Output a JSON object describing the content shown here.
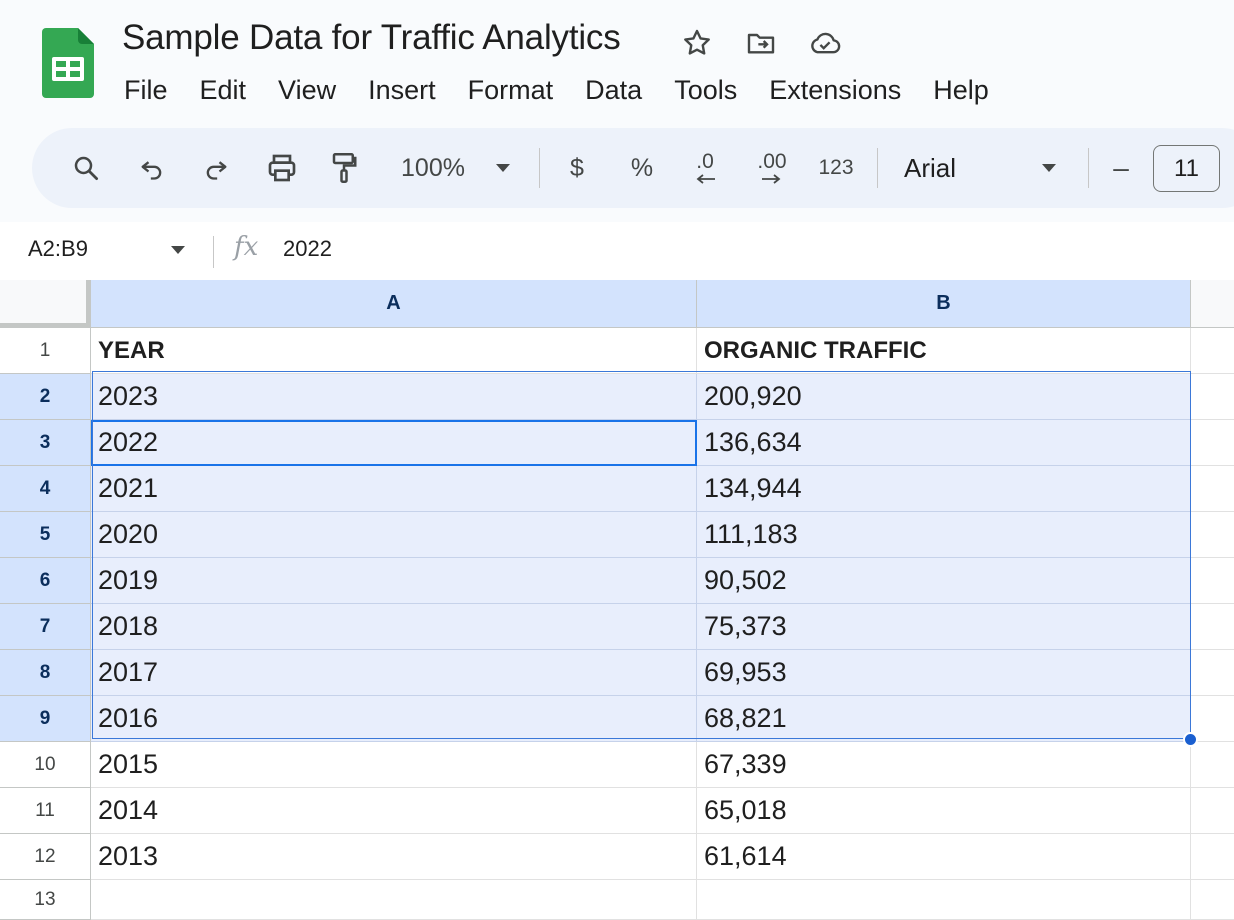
{
  "document": {
    "title": "Sample Data for Traffic Analytics"
  },
  "title_icons": [
    "star-icon",
    "move-to-folder-icon",
    "cloud-saved-icon"
  ],
  "menu": [
    "File",
    "Edit",
    "View",
    "Insert",
    "Format",
    "Data",
    "Tools",
    "Extensions",
    "Help"
  ],
  "toolbar": {
    "zoom": "100%",
    "currency": "$",
    "percent": "%",
    "decrease_decimal": ".0",
    "increase_decimal": ".00",
    "number_format": "123",
    "font": "Arial",
    "font_size": "11",
    "font_size_decrease": "–"
  },
  "formula_bar": {
    "name_box": "A2:B9",
    "fx": "fx",
    "value": "2022"
  },
  "sheet": {
    "columns": [
      "A",
      "B"
    ],
    "rows": [
      {
        "num": "1",
        "a": "YEAR",
        "b": "ORGANIC TRAFFIC"
      },
      {
        "num": "2",
        "a": "2023",
        "b": "200,920"
      },
      {
        "num": "3",
        "a": "2022",
        "b": "136,634"
      },
      {
        "num": "4",
        "a": "2021",
        "b": "134,944"
      },
      {
        "num": "5",
        "a": "2020",
        "b": "111,183"
      },
      {
        "num": "6",
        "a": "2019",
        "b": "90,502"
      },
      {
        "num": "7",
        "a": "2018",
        "b": "75,373"
      },
      {
        "num": "8",
        "a": "2017",
        "b": "69,953"
      },
      {
        "num": "9",
        "a": "2016",
        "b": "68,821"
      },
      {
        "num": "10",
        "a": "2015",
        "b": "67,339"
      },
      {
        "num": "11",
        "a": "2014",
        "b": "65,018"
      },
      {
        "num": "12",
        "a": "2013",
        "b": "61,614"
      },
      {
        "num": "13",
        "a": "",
        "b": ""
      }
    ],
    "selected_range": "A2:B9",
    "active_cell": "A3"
  },
  "colors": {
    "accent": "#1a73e8",
    "selection_fill": "#e8eefc",
    "header_selected": "#d3e3fd",
    "sheets_green": "#0f9d58"
  }
}
